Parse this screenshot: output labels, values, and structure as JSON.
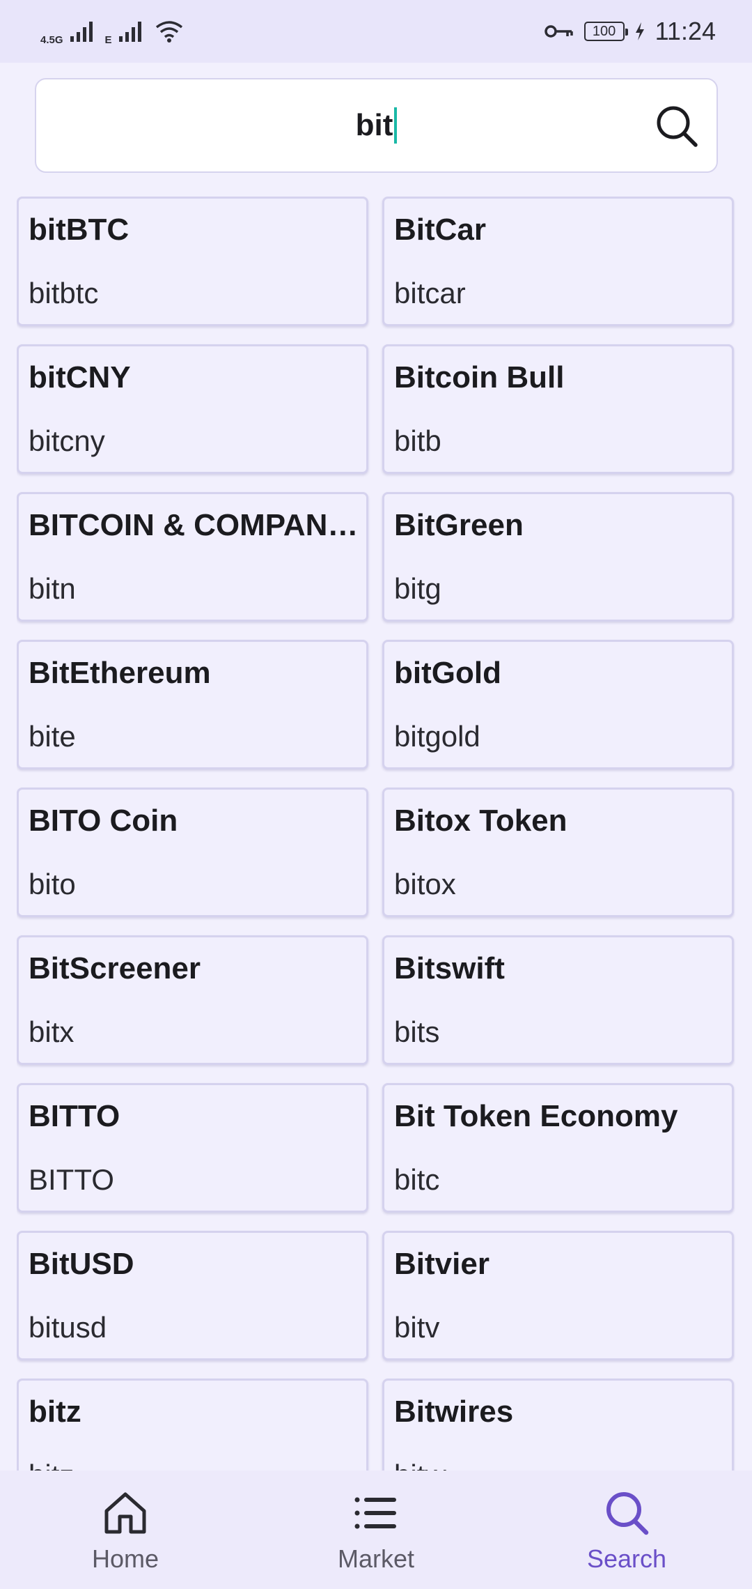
{
  "status_bar": {
    "network1": "4.5G",
    "network2": "E",
    "battery": "100",
    "time": "11:24"
  },
  "search": {
    "value": "bit",
    "icon": "search-icon"
  },
  "results": [
    {
      "name": "bitBTC",
      "symbol": "bitbtc"
    },
    {
      "name": "BitCar",
      "symbol": "bitcar"
    },
    {
      "name": "bitCNY",
      "symbol": "bitcny"
    },
    {
      "name": "Bitcoin Bull",
      "symbol": "bitb"
    },
    {
      "name": "BITCOIN & COMPAN…",
      "symbol": "bitn"
    },
    {
      "name": "BitGreen",
      "symbol": "bitg"
    },
    {
      "name": "BitEthereum",
      "symbol": "bite"
    },
    {
      "name": "bitGold",
      "symbol": "bitgold"
    },
    {
      "name": "BITO Coin",
      "symbol": "bito"
    },
    {
      "name": "Bitox Token",
      "symbol": "bitox"
    },
    {
      "name": "BitScreener",
      "symbol": "bitx"
    },
    {
      "name": "Bitswift",
      "symbol": "bits"
    },
    {
      "name": "BITTO",
      "symbol": "BITTO"
    },
    {
      "name": "Bit Token Economy",
      "symbol": "bitc"
    },
    {
      "name": "BitUSD",
      "symbol": "bitusd"
    },
    {
      "name": "Bitvier",
      "symbol": "bitv"
    },
    {
      "name": "bitz",
      "symbol": "bitz"
    },
    {
      "name": "Bitwires",
      "symbol": "bitw"
    }
  ],
  "bottom_nav": {
    "items": [
      {
        "label": "Home",
        "icon": "home-icon",
        "active": false
      },
      {
        "label": "Market",
        "icon": "list-icon",
        "active": false
      },
      {
        "label": "Search",
        "icon": "search-icon",
        "active": true
      }
    ]
  },
  "colors": {
    "accent": "#6A4FC8",
    "caret": "#19B8A6",
    "background": "#F2F0FD"
  }
}
